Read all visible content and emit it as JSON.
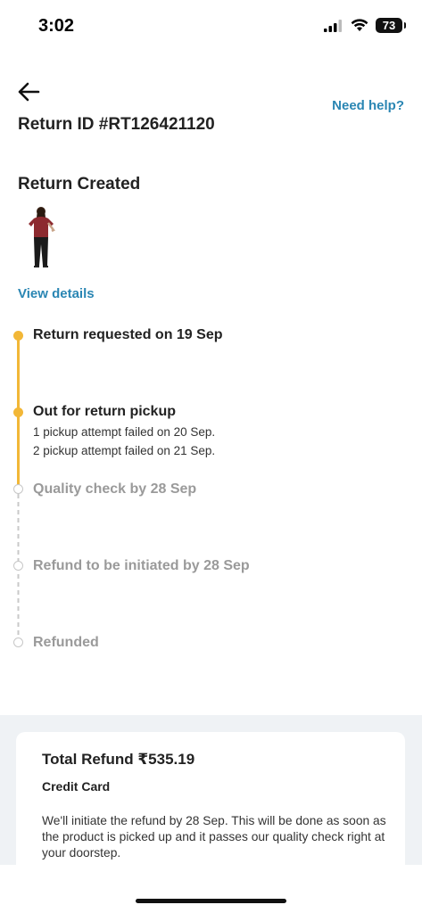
{
  "status_bar": {
    "time": "3:02",
    "battery": "73"
  },
  "header": {
    "need_help": "Need help?",
    "return_id": "Return ID #RT126421120"
  },
  "return_status": {
    "title": "Return Created",
    "view_details": "View details"
  },
  "timeline": {
    "step1": {
      "label": "Return requested on 19 Sep"
    },
    "step2": {
      "label": "Out for return pickup",
      "sub1": "1 pickup attempt failed on 20 Sep.",
      "sub2": "2 pickup attempt failed on 21 Sep."
    },
    "step3": {
      "label": "Quality check by 28 Sep"
    },
    "step4": {
      "label": "Refund to be initiated by 28 Sep"
    },
    "step5": {
      "label": "Refunded"
    }
  },
  "refund": {
    "total": "Total Refund ₹535.19",
    "method": "Credit Card",
    "description": "We'll initiate the refund by 28 Sep. This will be done as soon as the product is picked up and it passes our quality check right at your doorstep."
  },
  "colors": {
    "accent": "#f2b737",
    "link": "#2a86b3",
    "pending": "#9a9a9a"
  }
}
